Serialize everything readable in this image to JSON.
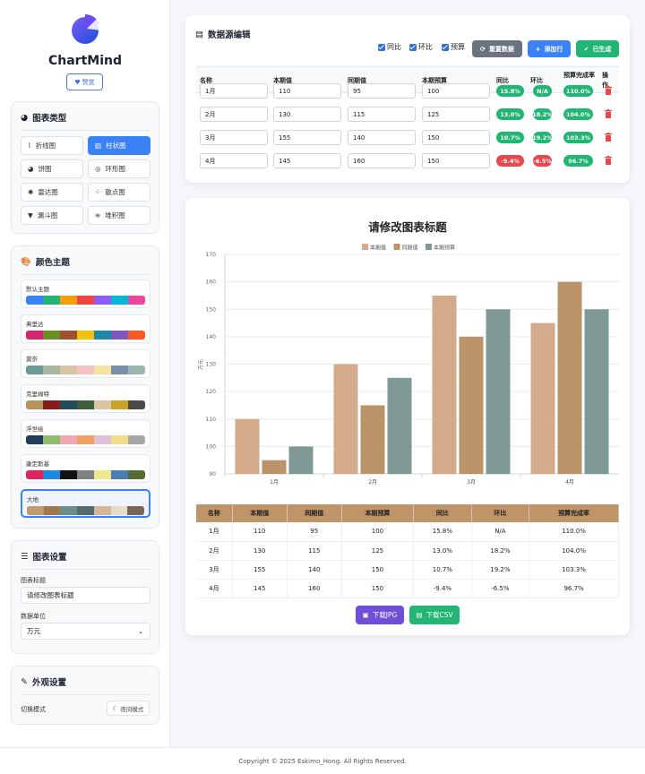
{
  "app": {
    "brand": "ChartMind",
    "like_label": "赞赏"
  },
  "chart_types": {
    "title": "图表类型",
    "items": [
      {
        "label": "折线图",
        "icon": "line-chart-icon"
      },
      {
        "label": "柱状图",
        "icon": "bar-chart-icon",
        "active": true
      },
      {
        "label": "饼图",
        "icon": "pie-chart-icon"
      },
      {
        "label": "环形图",
        "icon": "donut-chart-icon"
      },
      {
        "label": "雷达图",
        "icon": "radar-chart-icon"
      },
      {
        "label": "散点图",
        "icon": "scatter-chart-icon"
      },
      {
        "label": "漏斗图",
        "icon": "funnel-chart-icon"
      },
      {
        "label": "堆积图",
        "icon": "stack-chart-icon"
      }
    ]
  },
  "themes": {
    "title": "颜色主题",
    "items": [
      {
        "name": "默认主题",
        "colors": [
          "#3b82f6",
          "#22b573",
          "#f59e0b",
          "#ef4444",
          "#8b5cf6",
          "#06b6d4",
          "#ec4899"
        ]
      },
      {
        "name": "弗里达",
        "colors": [
          "#d6246e",
          "#6b8e23",
          "#a0522d",
          "#f4c20d",
          "#1e88a8",
          "#7e57c2",
          "#ff5722"
        ]
      },
      {
        "name": "莫奈",
        "colors": [
          "#6b9a96",
          "#a9b7a0",
          "#d8c3a5",
          "#f4c2c2",
          "#f3e3a0",
          "#7b8ea8",
          "#9fb5b0"
        ]
      },
      {
        "name": "克里姆特",
        "colors": [
          "#b8935a",
          "#8b1a1a",
          "#1f4e5a",
          "#3c5e3a",
          "#d8c6a0",
          "#c9a227",
          "#4a4a4a"
        ]
      },
      {
        "name": "浮世绘",
        "colors": [
          "#1f3d5c",
          "#8fbc6a",
          "#f2a7b0",
          "#f0a060",
          "#e0c0d8",
          "#f3dc8a",
          "#a7a7a7"
        ]
      },
      {
        "name": "康定斯基",
        "colors": [
          "#e0245e",
          "#1e88e5",
          "#111111",
          "#808080",
          "#f0e68c",
          "#4a7fb5",
          "#556b2f"
        ]
      },
      {
        "name": "大地",
        "colors": [
          "#c19a6b",
          "#a0784a",
          "#6b8e8a",
          "#556b6b",
          "#d4b896",
          "#e8dcc8",
          "#7a6656"
        ],
        "selected": true
      }
    ]
  },
  "settings": {
    "title": "图表设置",
    "title_label": "图表标题",
    "title_value": "请修改图表标题",
    "unit_label": "数据单位",
    "unit_value": "万元"
  },
  "appearance": {
    "title": "外观设置",
    "mode_label": "切换模式",
    "night_label": "夜间模式"
  },
  "editor": {
    "title": "数据源编辑",
    "checks": [
      "同比",
      "环比",
      "预算"
    ],
    "reset_label": "重置数据",
    "add_label": "添加行",
    "generated_label": "已生成",
    "headers": [
      "名称",
      "本期值",
      "同期值",
      "本期预算",
      "同比",
      "环比",
      "预算完成率",
      "操作"
    ],
    "rows": [
      {
        "name": "1月",
        "cur": "110",
        "prev": "95",
        "budget": "100",
        "yoy": "15.8%",
        "mom": "N/A",
        "rate": "110.0%"
      },
      {
        "name": "2月",
        "cur": "130",
        "prev": "115",
        "budget": "125",
        "yoy": "13.0%",
        "mom": "18.2%",
        "rate": "104.0%"
      },
      {
        "name": "3月",
        "cur": "155",
        "prev": "140",
        "budget": "150",
        "yoy": "10.7%",
        "mom": "19.2%",
        "rate": "103.3%"
      },
      {
        "name": "4月",
        "cur": "145",
        "prev": "160",
        "budget": "150",
        "yoy": "-9.4%",
        "mom": "-6.5%",
        "rate": "96.7%"
      }
    ]
  },
  "chart_data": {
    "type": "bar",
    "title": "请修改图表标题",
    "categories": [
      "1月",
      "2月",
      "3月",
      "4月"
    ],
    "series": [
      {
        "name": "本期值",
        "values": [
          110,
          130,
          155,
          145
        ],
        "color": "#d4ab8a"
      },
      {
        "name": "同期值",
        "values": [
          95,
          115,
          140,
          160
        ],
        "color": "#bb9369"
      },
      {
        "name": "本期预算",
        "values": [
          100,
          125,
          150,
          150
        ],
        "color": "#7f9a96"
      }
    ],
    "ylabel": "万元",
    "ylim": [
      90,
      170
    ],
    "yticks": [
      90,
      100,
      110,
      120,
      130,
      140,
      150,
      160,
      170
    ],
    "legend": "top",
    "grid": true
  },
  "summary_table": {
    "headers": [
      "名称",
      "本期值",
      "同期值",
      "本期预算",
      "同比",
      "环比",
      "预算完成率"
    ],
    "rows": [
      [
        "1月",
        "110",
        "95",
        "100",
        "15.8%",
        "N/A",
        "110.0%"
      ],
      [
        "2月",
        "130",
        "115",
        "125",
        "13.0%",
        "18.2%",
        "104.0%"
      ],
      [
        "3月",
        "155",
        "140",
        "150",
        "10.7%",
        "19.2%",
        "103.3%"
      ],
      [
        "4月",
        "145",
        "160",
        "150",
        "-9.4%",
        "-6.5%",
        "96.7%"
      ]
    ]
  },
  "download": {
    "jpg_label": "下载JPG",
    "csv_label": "下载CSV"
  },
  "footer": "Copyright © 2025 Eskimo_Hong. All Rights Reserved."
}
